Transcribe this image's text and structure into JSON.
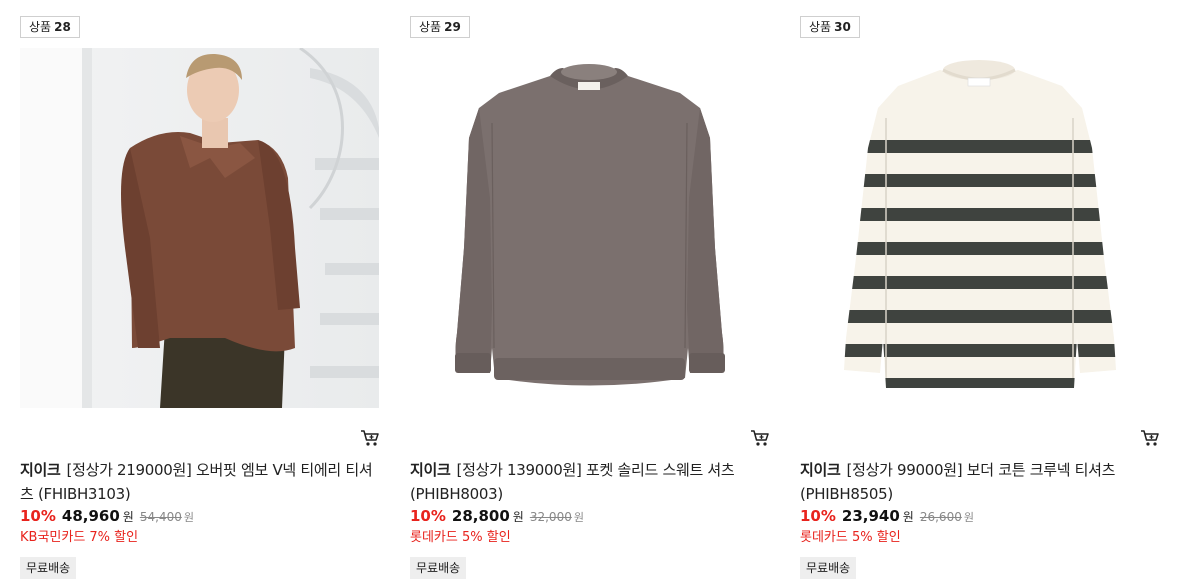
{
  "products": [
    {
      "badge_prefix": "상품",
      "badge_num": "28",
      "brand": "지이크",
      "name": "[정상가 219000원] 오버핏 엠보 V넥 티에리 티셔츠 (FHIBH3103)",
      "discount": "10%",
      "price": "48,960",
      "price_unit": "원",
      "original_price": "54,400",
      "original_unit": "원",
      "card_promo": "KB국민카드 7% 할인",
      "shipping": "무료배송",
      "image_icon": "model-brown-polo-photo"
    },
    {
      "badge_prefix": "상품",
      "badge_num": "29",
      "brand": "지이크",
      "name": "[정상가 139000원] 포켓 솔리드 스웨트 셔츠 (PHIBH8003)",
      "discount": "10%",
      "price": "28,800",
      "price_unit": "원",
      "original_price": "32,000",
      "original_unit": "원",
      "card_promo": "롯데카드 5% 할인",
      "shipping": "무료배송",
      "image_icon": "grey-sweatshirt-photo"
    },
    {
      "badge_prefix": "상품",
      "badge_num": "30",
      "brand": "지이크",
      "name": "[정상가 99000원] 보더 코튼 크루넥 티셔츠 (PHIBH8505)",
      "discount": "10%",
      "price": "23,940",
      "price_unit": "원",
      "original_price": "26,600",
      "original_unit": "원",
      "card_promo": "롯데카드 5% 할인",
      "shipping": "무료배송",
      "image_icon": "striped-tshirt-photo"
    }
  ],
  "colors": {
    "accent_red": "#e8231d",
    "text": "#222222",
    "muted": "#888888",
    "ship_bg": "#eeeeee"
  }
}
